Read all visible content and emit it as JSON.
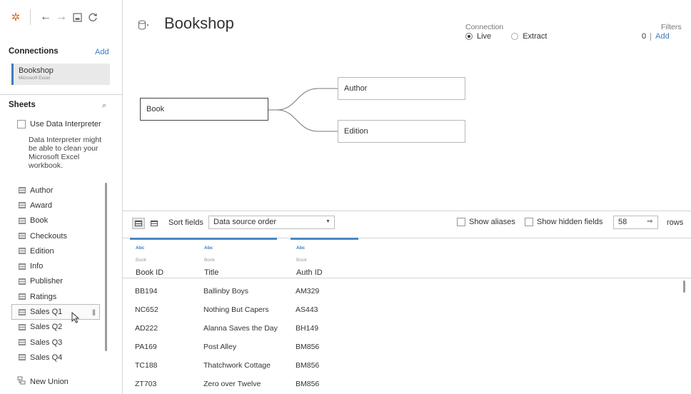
{
  "toolbar": {
    "logo_icon": "tableau-logo-icon",
    "back_icon": "arrow-left-icon",
    "forward_icon": "arrow-right-icon",
    "save_icon": "save-icon",
    "refresh_icon": "refresh-icon"
  },
  "connections": {
    "title": "Connections",
    "add_label": "Add",
    "items": [
      {
        "name": "Bookshop",
        "type": "Microsoft Excel"
      }
    ]
  },
  "sheets_panel": {
    "title": "Sheets",
    "interpreter_label": "Use Data Interpreter",
    "interpreter_note": "Data Interpreter might be able to clean your Microsoft Excel workbook.",
    "items": [
      "Author",
      "Award",
      "Book",
      "Checkouts",
      "Edition",
      "Info",
      "Publisher",
      "Ratings",
      "Sales Q1",
      "Sales Q2",
      "Sales Q3",
      "Sales Q4"
    ],
    "new_union_label": "New Union"
  },
  "datasource": {
    "title": "Bookshop",
    "connection_label": "Connection",
    "live_label": "Live",
    "extract_label": "Extract",
    "selected_connection": "Live",
    "filters_label": "Filters",
    "filters_count": "0",
    "filters_add": "Add"
  },
  "canvas": {
    "root_table": "Book",
    "joined_tables": [
      "Author",
      "Edition"
    ]
  },
  "grid_toolbar": {
    "sort_label": "Sort fields",
    "sort_value": "Data source order",
    "show_aliases": "Show aliases",
    "show_hidden": "Show hidden fields",
    "rows_value": "58",
    "rows_label": "rows"
  },
  "grid": {
    "columns": [
      {
        "type": "Abc",
        "source": "Book",
        "name": "Book ID"
      },
      {
        "type": "Abc",
        "source": "Book",
        "name": "Title"
      },
      {
        "type": "Abc",
        "source": "Book",
        "name": "Auth ID"
      }
    ],
    "rows": [
      [
        "BB194",
        "Ballinby Boys",
        "AM329"
      ],
      [
        "NC652",
        "Nothing But Capers",
        "AS443"
      ],
      [
        "AD222",
        "Alanna Saves the Day",
        "BH149"
      ],
      [
        "PA169",
        "Post Alley",
        "BM856"
      ],
      [
        "TC188",
        "Thatchwork Cottage",
        "BM856"
      ],
      [
        "ZT703",
        "Zero over Twelve",
        "BM856"
      ]
    ]
  },
  "colors": {
    "accent": "#3e7cbf",
    "column_header_bar": "#4a86c5",
    "logo": "#e06a2b"
  }
}
